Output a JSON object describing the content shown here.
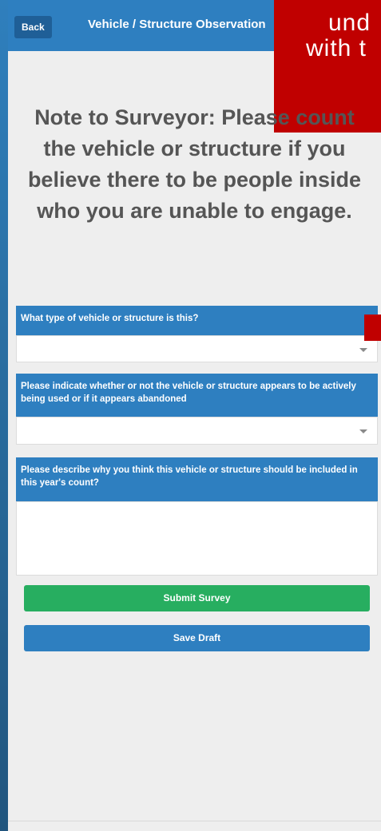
{
  "header": {
    "back_label": "Back",
    "title": "Vehicle / Structure Observation"
  },
  "overlay": {
    "line1": "und",
    "line2": "with t"
  },
  "note": "Note to Surveyor: Please count the vehicle or structure if you believe there to be people inside who you are unable to engage.",
  "form": {
    "vehicle_type": {
      "label": "What type of vehicle or structure is this?",
      "value": ""
    },
    "usage_status": {
      "label": "Please indicate whether or not the vehicle or structure appears to be actively being used or if it appears abandoned",
      "value": ""
    },
    "reason": {
      "label": "Please describe why you think this vehicle or structure should be included in this year's count?",
      "value": ""
    }
  },
  "buttons": {
    "submit": "Submit Survey",
    "save_draft": "Save Draft"
  },
  "colors": {
    "header_blue": "#2e7fc0",
    "overlay_red": "#c00000",
    "submit_green": "#27ae60"
  }
}
